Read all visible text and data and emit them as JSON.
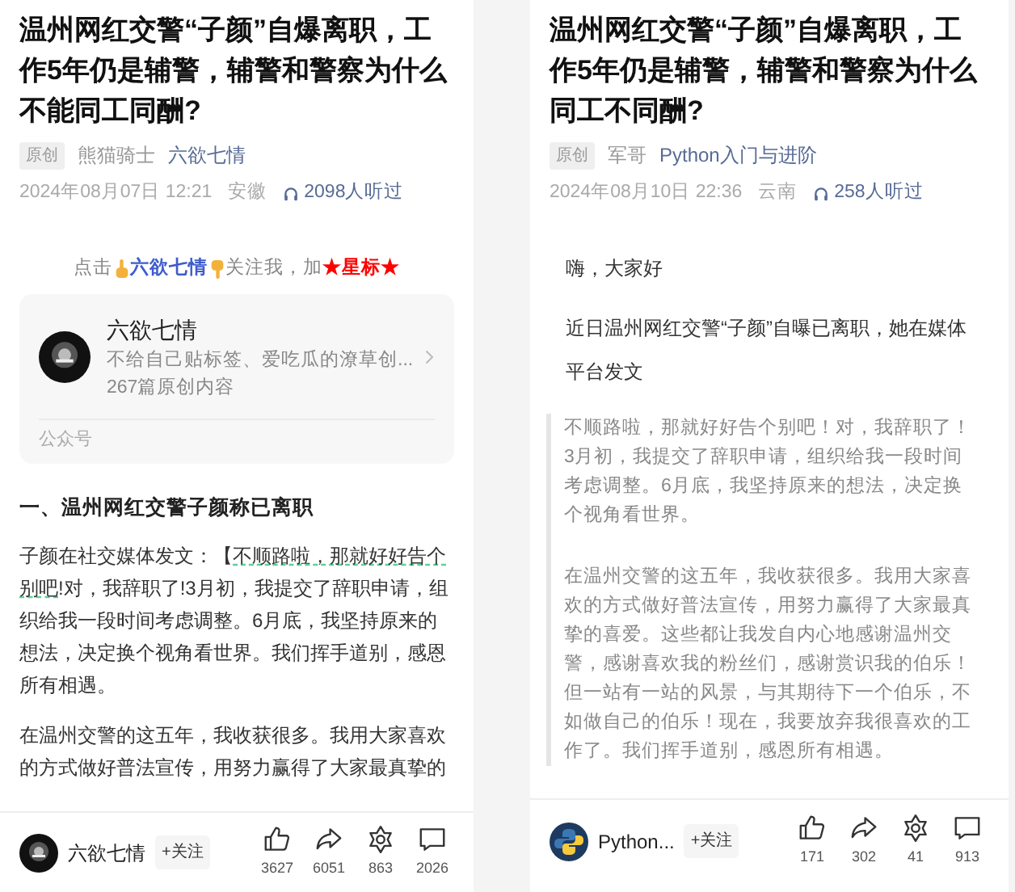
{
  "left_article": {
    "title": "温州网红交警“子颜”自爆离职，工作5年仍是辅警，辅警和警察为什么不能同工同酬?",
    "original_badge": "原创",
    "author": "熊猫骑士",
    "account": "六欲七情",
    "date": "2024年08月07日 12:21",
    "location": "安徽",
    "listens": "2098人听过",
    "promo": {
      "before": "点击",
      "account": "六欲七情",
      "after": "关注我，加",
      "star_label": "★星标★"
    },
    "account_card": {
      "name": "六欲七情",
      "description": "不给自己贴标签、爱吃瓜的潦草创...",
      "count": "267篇原创内容",
      "footer": "公众号"
    },
    "body": [
      {
        "kind": "heading",
        "text": "一、温州网红交警子颜称已离职"
      },
      {
        "kind": "paragraph",
        "parts": [
          {
            "text": "子颜在社交媒体发文：【",
            "underlined": false
          },
          {
            "text": "不顺路啦，那就好好告个别吧",
            "underlined": true
          },
          {
            "text": "!对，我辞职了!3月初，我提交了辞职申请，组织给我一段时间考虑调整。6月底，我坚持原来的想法，决定换个视角看世界。我们挥手道别，感恩所有相遇。",
            "underlined": false
          }
        ]
      },
      {
        "kind": "paragraph",
        "parts": [
          {
            "text": "在温州交警的这五年，我收获很多。我用大家喜欢的方式做好普法宣传，用努力赢得了大家最真挚的",
            "underlined": false
          }
        ]
      }
    ],
    "bottom_bar": {
      "name": "六欲七情",
      "follow": "+关注",
      "actions": [
        {
          "kind": "like",
          "count": "3627"
        },
        {
          "kind": "share",
          "count": "6051"
        },
        {
          "kind": "flower",
          "count": "863"
        },
        {
          "kind": "comment",
          "count": "2026"
        }
      ]
    }
  },
  "right_article": {
    "title": "温州网红交警“子颜”自爆离职，工作5年仍是辅警，辅警和警察为什么同工不同酬?",
    "original_badge": "原创",
    "author": "军哥",
    "account": "Python入门与进阶",
    "date": "2024年08月10日 22:36",
    "location": "云南",
    "listens": "258人听过",
    "body": [
      {
        "kind": "greeting",
        "text": "嗨，大家好"
      },
      {
        "kind": "paragraph",
        "text": "近日温州网红交警“子颜”自曝已离职，她在媒体平台发文"
      },
      {
        "kind": "quote",
        "paragraphs": [
          "不顺路啦，那就好好告个别吧！对，我辞职了！3月初，我提交了辞职申请，组织给我一段时间考虑调整。6月底，我坚持原来的想法，决定换个视角看世界。",
          "在温州交警的这五年，我收获很多。我用大家喜欢的方式做好普法宣传，用努力赢得了大家最真挚的喜爱。这些都让我发自内心地感谢温州交警，感谢喜欢我的粉丝们，感谢赏识我的伯乐！但一站有一站的风景，与其期待下一个伯乐，不如做自己的伯乐！现在，我要放弃我很喜欢的工作了。我们挥手道别，感恩所有相遇。"
        ]
      }
    ],
    "bottom_bar": {
      "name": "Python...",
      "follow": "+关注",
      "actions": [
        {
          "kind": "like",
          "count": "171"
        },
        {
          "kind": "share",
          "count": "302"
        },
        {
          "kind": "flower",
          "count": "41"
        },
        {
          "kind": "comment",
          "count": "913"
        }
      ]
    }
  }
}
